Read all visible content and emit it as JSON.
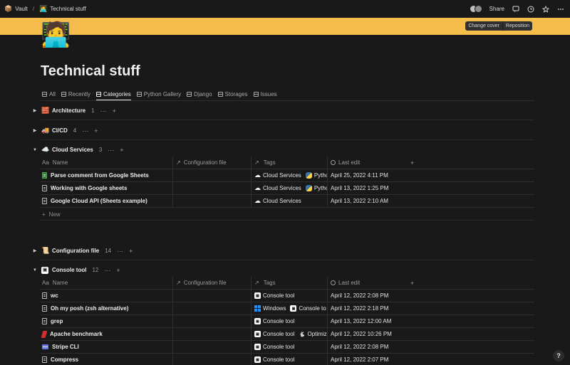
{
  "breadcrumb": {
    "workspace_icon": "📦",
    "workspace": "Vault",
    "separator": "/",
    "page_icon": "🧑‍💻",
    "page": "Technical stuff"
  },
  "topbar": {
    "share_label": "Share"
  },
  "cover": {
    "change_label": "Change cover",
    "reposition_label": "Reposition",
    "color": "#f5bb4b"
  },
  "page": {
    "icon": "🧑‍💻",
    "title": "Technical stuff"
  },
  "tabs": [
    {
      "label": "All"
    },
    {
      "label": "Recently"
    },
    {
      "label": "Categories"
    },
    {
      "label": "Python Gallery"
    },
    {
      "label": "Django"
    },
    {
      "label": "Storages"
    },
    {
      "label": "Issues"
    }
  ],
  "columns": {
    "name": "Name",
    "config": "Configuration file",
    "tags": "Tags",
    "last_edit": "Last edit",
    "add": "+"
  },
  "groups": {
    "architecture": {
      "emoji": "🧱",
      "name": "Architecture",
      "count": "1"
    },
    "cicd": {
      "emoji": "🚚",
      "name": "CI/CD",
      "count": "4"
    },
    "cloud": {
      "emoji": "☁️",
      "name": "Cloud Services",
      "count": "3"
    },
    "config": {
      "emoji": "📜",
      "name": "Configuration file",
      "count": "14"
    },
    "console": {
      "emoji": "▣",
      "name": "Console tool",
      "count": "12"
    }
  },
  "group_actions": {
    "more": "···",
    "add": "+"
  },
  "new_label": "New",
  "cloud_rows": [
    {
      "name": "Parse comment from Google Sheets",
      "tag1": "Cloud Services",
      "tag2": "Pytho",
      "date": "April 25, 2022 4:11 PM"
    },
    {
      "name": "Working with Google sheets",
      "tag1": "Cloud Services",
      "tag2": "Pytho",
      "date": "April 13, 2022 1:25 PM"
    },
    {
      "name": "Google Cloud API (Sheets example)",
      "tag1": "Cloud Services",
      "date": "April 13, 2022 2:10 AM"
    }
  ],
  "console_rows": [
    {
      "name": "wc",
      "tag1": "Console tool",
      "date": "April 12, 2022 2:08 PM"
    },
    {
      "name": "Oh my posh (zsh alternative)",
      "tag1": "Windows",
      "tag2": "Console to",
      "date": "April 12, 2022 2:18 PM"
    },
    {
      "name": "grep",
      "tag1": "Console tool",
      "date": "April 13, 2022 12:00 AM"
    },
    {
      "name": "Apache benchmark",
      "tag1": "Console tool",
      "tag2": "Optimiz",
      "date": "April 12, 2022 10:26 PM"
    },
    {
      "name": "Stripe CLI",
      "tag1": "Console tool",
      "date": "April 12, 2022 2:08 PM"
    },
    {
      "name": "Compress",
      "tag1": "Console tool",
      "date": "April 12, 2022 2:07 PM"
    }
  ],
  "help_label": "?"
}
